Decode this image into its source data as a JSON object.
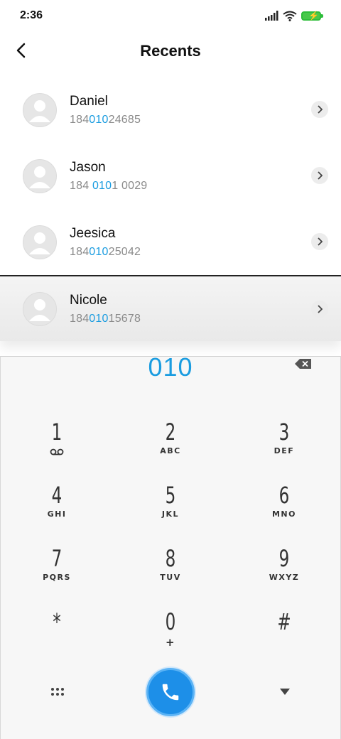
{
  "status_bar": {
    "time": "2:36"
  },
  "header": {
    "title": "Recents"
  },
  "contacts": [
    {
      "name": "Daniel",
      "number_pre": "184",
      "number_match": "010",
      "number_post": "24685"
    },
    {
      "name": "Jason",
      "number_pre": "184 ",
      "number_match": "010",
      "number_post": "1 0029"
    },
    {
      "name": "Jeesica",
      "number_pre": "184",
      "number_match": "010",
      "number_post": "25042"
    },
    {
      "name": "Nicole",
      "number_pre": "184",
      "number_match": "010",
      "number_post": "15678"
    }
  ],
  "dialpad": {
    "input": "010",
    "keys": [
      {
        "digit": "1",
        "letters": ""
      },
      {
        "digit": "2",
        "letters": "ABC"
      },
      {
        "digit": "3",
        "letters": "DEF"
      },
      {
        "digit": "4",
        "letters": "GHI"
      },
      {
        "digit": "5",
        "letters": "JKL"
      },
      {
        "digit": "6",
        "letters": "MNO"
      },
      {
        "digit": "7",
        "letters": "PQRS"
      },
      {
        "digit": "8",
        "letters": "TUV"
      },
      {
        "digit": "9",
        "letters": "WXYZ"
      },
      {
        "digit": "*",
        "letters": ""
      },
      {
        "digit": "0",
        "letters": "+"
      },
      {
        "digit": "#",
        "letters": ""
      }
    ]
  },
  "colors": {
    "accent": "#1a9ce0",
    "call_button": "#1d8fe8",
    "battery": "#47c84a"
  },
  "icons": {
    "back": "chevron-left-icon",
    "contact_detail": "chevron-right-icon",
    "backspace": "backspace-icon",
    "voicemail": "voicemail-icon",
    "grid": "dots-grid-icon",
    "call": "phone-icon",
    "collapse": "triangle-down-icon"
  }
}
